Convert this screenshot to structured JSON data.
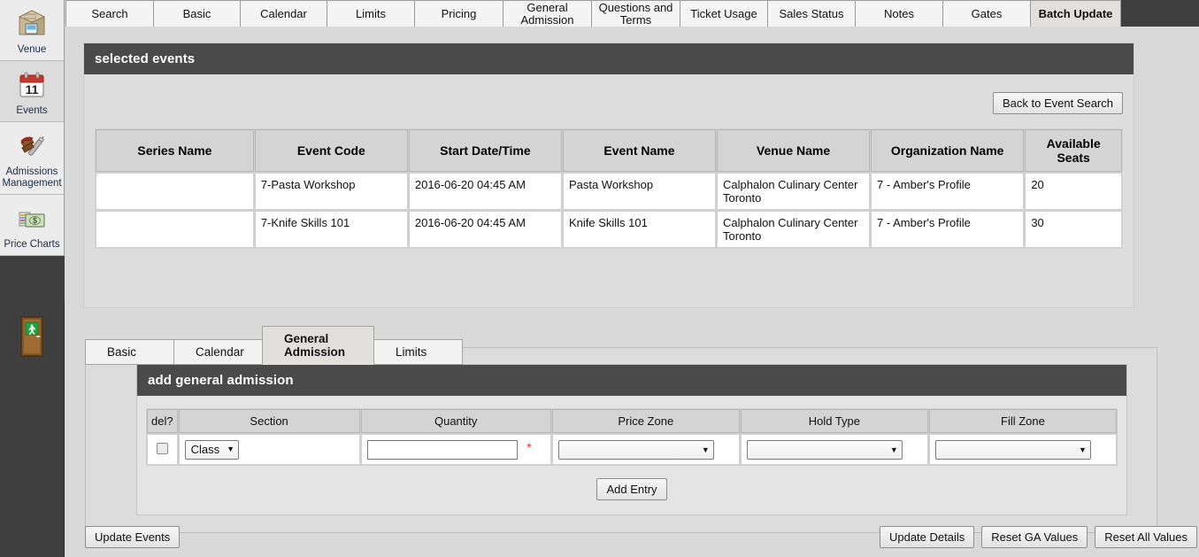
{
  "sidebar": {
    "items": [
      {
        "label": "Venue",
        "icon": "venue-building-icon"
      },
      {
        "label": "Events",
        "icon": "calendar-icon"
      },
      {
        "label": "Admissions Management",
        "icon": "admissions-tools-icon"
      },
      {
        "label": "Price Charts",
        "icon": "money-price-icon"
      }
    ],
    "exit": {
      "label": "",
      "icon": "exit-door-icon"
    }
  },
  "top_tabs": [
    {
      "label": "Search",
      "active": false
    },
    {
      "label": "Basic",
      "active": false
    },
    {
      "label": "Calendar",
      "active": false
    },
    {
      "label": "Limits",
      "active": false
    },
    {
      "label": "Pricing",
      "active": false
    },
    {
      "label": "General Admission",
      "active": false
    },
    {
      "label": "Questions and Terms",
      "active": false
    },
    {
      "label": "Ticket Usage",
      "active": false
    },
    {
      "label": "Sales Status",
      "active": false
    },
    {
      "label": "Notes",
      "active": false
    },
    {
      "label": "Gates",
      "active": false
    },
    {
      "label": "Batch Update",
      "active": true
    }
  ],
  "selected_events": {
    "header": "selected events",
    "back_button": "Back to Event Search",
    "columns": [
      "Series Name",
      "Event Code",
      "Start Date/Time",
      "Event Name",
      "Venue Name",
      "Organization Name",
      "Available Seats"
    ],
    "rows": [
      {
        "series_name": "",
        "event_code": "7-Pasta Workshop",
        "start_datetime": "2016-06-20 04:45 AM",
        "event_name": "Pasta Workshop",
        "venue_name": "Calphalon Culinary Center Toronto",
        "organization_name": "7 - Amber's Profile",
        "available_seats": "20"
      },
      {
        "series_name": "",
        "event_code": "7-Knife Skills 101",
        "start_datetime": "2016-06-20 04:45 AM",
        "event_name": "Knife Skills 101",
        "venue_name": "Calphalon Culinary Center Toronto",
        "organization_name": "7 - Amber's Profile",
        "available_seats": "30"
      }
    ]
  },
  "inner_tabs": [
    {
      "label": "Basic",
      "active": false
    },
    {
      "label": "Calendar",
      "active": false
    },
    {
      "label": "General Admission",
      "active": true
    },
    {
      "label": "Limits",
      "active": false
    }
  ],
  "general_admission": {
    "header": "add general admission",
    "columns": [
      "del?",
      "Section",
      "Quantity",
      "Price Zone",
      "Hold Type",
      "Fill Zone"
    ],
    "row": {
      "delete_checked": false,
      "section_value": "Class",
      "quantity_value": "",
      "quantity_required": "*",
      "price_zone_value": "",
      "hold_type_value": "",
      "fill_zone_value": ""
    },
    "add_entry_button": "Add Entry"
  },
  "footer": {
    "update_events": "Update Events",
    "update_details": "Update Details",
    "reset_ga_values": "Reset GA Values",
    "reset_all_values": "Reset All Values"
  },
  "colors": {
    "header_bar": "#4a4a4a",
    "chrome_dark": "#3f3f3f",
    "page_bg": "#d9d9d9",
    "required_star": "#d33333",
    "sidebar_label": "#1c2c4c"
  }
}
